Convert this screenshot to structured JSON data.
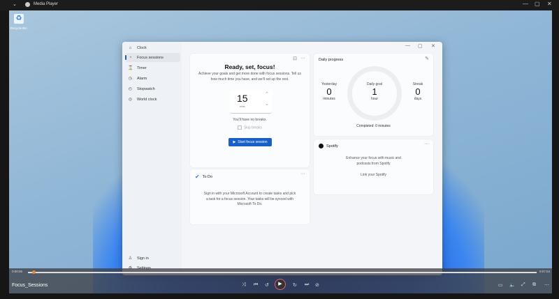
{
  "player": {
    "title": "Media Player",
    "back": "⌄",
    "min": "—",
    "max": "▢",
    "close": "✕",
    "file_name": "Focus_Sessions",
    "time_elapsed": "0:00:06",
    "time_total": "0:07:04",
    "progress": 0.01
  },
  "desktop": {
    "recycle_label": "Recycle Bin"
  },
  "clock": {
    "nav": [
      {
        "label": "Clock",
        "icon": "⌂"
      },
      {
        "label": "Focus sessions",
        "icon": "◔"
      },
      {
        "label": "Timer",
        "icon": "⌛"
      },
      {
        "label": "Alarm",
        "icon": "◷"
      },
      {
        "label": "Stopwatch",
        "icon": "◴"
      },
      {
        "label": "World clock",
        "icon": "◎"
      }
    ],
    "sign_in": "Sign in",
    "settings": "Settings",
    "focus": {
      "title": "Ready, set, focus!",
      "desc": "Achieve your goals and get more done with focus sessions. Tell us how much time you have, and we'll set up the rest.",
      "minutes": "15",
      "unit": "mins",
      "breaks": "You'll have no breaks.",
      "skip": "Skip breaks",
      "start": "Start focus session"
    },
    "todo": {
      "title": "To Do",
      "desc": "Sign in with your Microsoft Account to create tasks and pick a task for a focus session. Your tasks will be synced with Microsoft To Do."
    },
    "daily": {
      "title": "Daily progress",
      "yesterday_label": "Yesterday",
      "yesterday": "0",
      "yesterday_unit": "minutes",
      "goal_label": "Daily goal",
      "goal": "1",
      "goal_unit": "hour",
      "streak_label": "Streak",
      "streak": "0",
      "streak_unit": "days",
      "completed": "Completed: 0 minutes"
    },
    "spotify": {
      "title": "Spotify",
      "desc": "Enhance your focus with music and podcasts from Spotify",
      "link": "Link your Spotify"
    }
  }
}
